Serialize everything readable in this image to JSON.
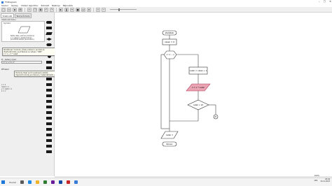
{
  "window": {
    "title": "FCDiagram"
  },
  "menu": [
    "Soubor",
    "Úpravy",
    "Vložení algoritmu",
    "Zobrazit",
    "Nástroje",
    "Nápověda"
  ],
  "toolbar": {
    "icons": [
      "new-icon",
      "open-icon",
      "save-icon",
      "print-icon",
      "cut-icon",
      "copy-icon",
      "paste-icon",
      "undo-icon",
      "redo-icon",
      "run-icon",
      "pause-icon",
      "step-icon",
      "stop-icon",
      "next-icon",
      "end-icon",
      "zoom-in-icon",
      "zoom-out-icon"
    ]
  },
  "left_panel": {
    "tabs": [
      "Vlastnosti",
      "Test průchodu"
    ],
    "props_label": "Vlastnosti bloku",
    "symbol_label": "Symbol:",
    "symbol_caption_lines": [
      "Načte data, uloží do proměnné",
      "x = vstupní / zadat hodnotu",
      "proměnné vstupu (ze souboru)"
    ],
    "help_tooltip_lines": [
      "Rozdělovací hodnotu (čísla) uložené v proměnné,",
      "Vlastnosti bloku je přiřazená na vstupu: \"ZZZ\"",
      "z = x + 1 * celek"
    ],
    "field_label": "Pr - zadaný výraz:",
    "field_value": "z = y + z + x²",
    "output_label": "Přiřazení",
    "output_help_lines": [
      "Hodnoty: Např se tím postupně ukládá...",
      "Výpočet hodnoty proměnné v matematickém výrazu"
    ],
    "output_items": [
      "x = 1",
      "celek = z",
      "y = celek x 1",
      "z = x²"
    ]
  },
  "canvas": {
    "start_label": "Začátek",
    "assign_label": "celek = 0",
    "loop_label": "i = 1 ... n",
    "calc_label": "celek = celek + 1",
    "input_label": "x = x * celek",
    "decision_label": "celek < 10",
    "connector_label": "E1",
    "output_label": "celek =",
    "end_label": "Konec"
  },
  "statusbar": {
    "zoom": "100%"
  },
  "taskbar": {
    "search": "Hledat",
    "time": "20:04",
    "date": "15.11.2023",
    "lang": "CES"
  }
}
